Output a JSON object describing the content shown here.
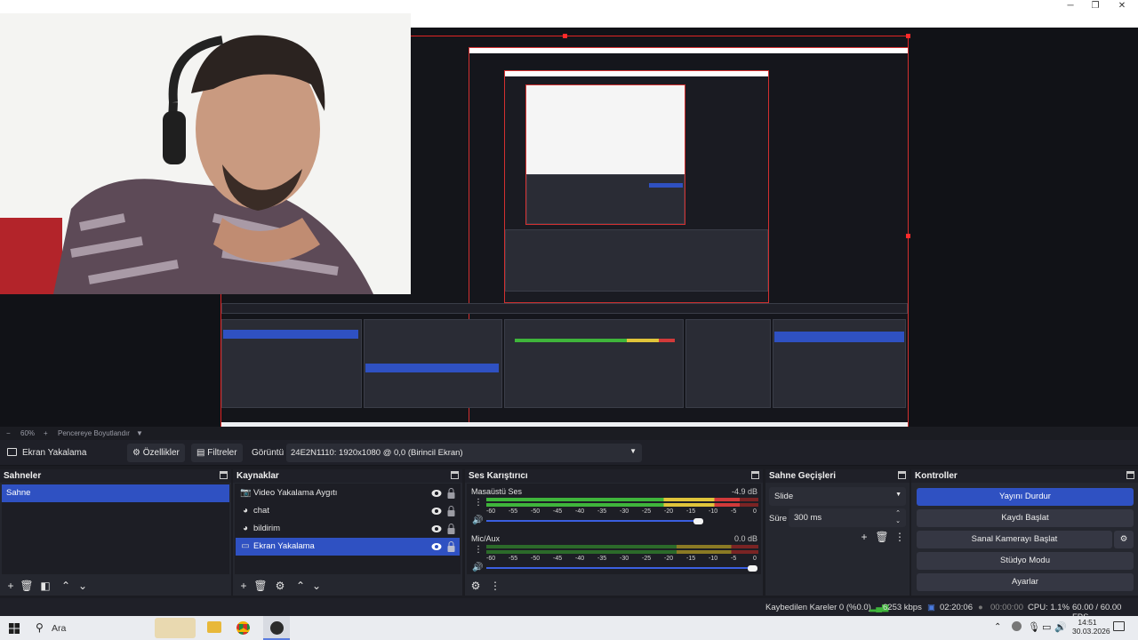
{
  "window": {
    "minimize": "─",
    "restore": "❐",
    "close": "✕"
  },
  "zoom": {
    "minus": "−",
    "value": "60%",
    "plus": "+",
    "fit_label": "Pencereye Boyutlandır",
    "dropdown": "▼"
  },
  "source_toolbar": {
    "current_source": "Ekran Yakalama",
    "properties_label": "Özellikler",
    "filters_label": "Filtreler",
    "display_label": "Görüntü",
    "display_value": "24E2N1110: 1920x1080 @ 0,0 (Birincil Ekran)"
  },
  "docks": {
    "scenes": {
      "title": "Sahneler",
      "items": [
        "Sahne"
      ]
    },
    "sources": {
      "title": "Kaynaklar",
      "items": [
        {
          "label": "Video Yakalama Aygıtı",
          "icon": "camera-icon"
        },
        {
          "label": "chat",
          "icon": "browser-icon"
        },
        {
          "label": "bildirim",
          "icon": "browser-icon"
        },
        {
          "label": "Ekran Yakalama",
          "icon": "monitor-icon"
        }
      ]
    },
    "mixer": {
      "title": "Ses Karıştırıcı",
      "channels": [
        {
          "name": "Masaüstü Ses",
          "db": "-4.9 dB",
          "level": 0.93,
          "volume": 1.0
        },
        {
          "name": "Mic/Aux",
          "db": "0.0 dB",
          "level": 0.0,
          "volume": 1.0
        }
      ],
      "ticks": [
        "-60",
        "-55",
        "-50",
        "-45",
        "-40",
        "-35",
        "-30",
        "-25",
        "-20",
        "-15",
        "-10",
        "-5",
        "0"
      ]
    },
    "transitions": {
      "title": "Sahne Geçişleri",
      "type": "Slide",
      "duration_label": "Süre",
      "duration_value": "300 ms"
    },
    "controls": {
      "title": "Kontroller",
      "buttons": [
        "Yayını Durdur",
        "Kaydı Başlat",
        "Sanal Kamerayı Başlat",
        "Stüdyo Modu",
        "Ayarlar"
      ]
    }
  },
  "status": {
    "dropped_frames": "Kaybedilen Kareler 0 (%0.0)",
    "bitrate": "6253 kbps",
    "stream_time": "02:20:06",
    "rec_time": "00:00:00",
    "cpu": "CPU: 1.1%",
    "fps": "60.00 / 60.00 FPS"
  },
  "taskbar": {
    "search_placeholder": "Ara",
    "time": "14:51",
    "date": "30.03.2026"
  },
  "colors": {
    "accent": "#2f51c2",
    "selection_border": "#e02424"
  }
}
